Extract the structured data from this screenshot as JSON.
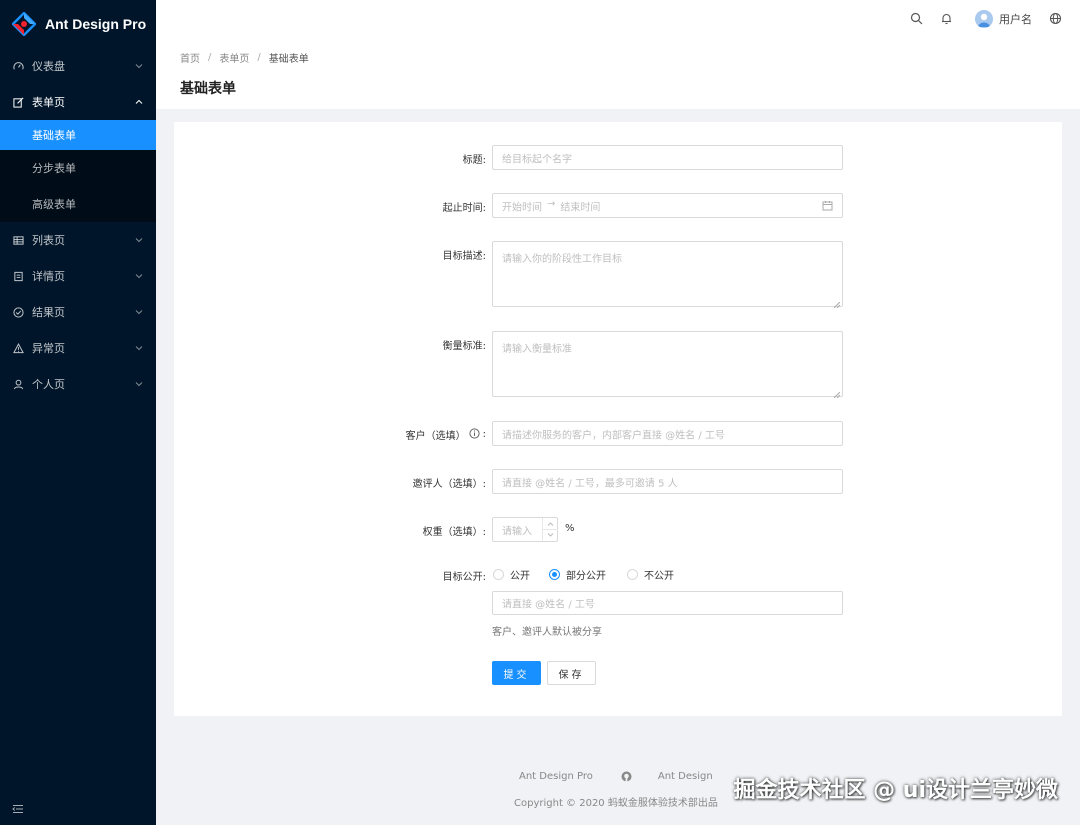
{
  "app": {
    "title": "Ant Design Pro"
  },
  "sidebar": {
    "items": [
      {
        "label": "仪表盘",
        "icon": "dashboard-icon"
      },
      {
        "label": "表单页",
        "icon": "form-icon",
        "open": true,
        "children": [
          {
            "label": "基础表单",
            "active": true
          },
          {
            "label": "分步表单"
          },
          {
            "label": "高级表单"
          }
        ]
      },
      {
        "label": "列表页",
        "icon": "table-icon"
      },
      {
        "label": "详情页",
        "icon": "profile-icon"
      },
      {
        "label": "结果页",
        "icon": "check-circle-icon"
      },
      {
        "label": "异常页",
        "icon": "warning-icon"
      },
      {
        "label": "个人页",
        "icon": "user-icon"
      }
    ]
  },
  "header": {
    "username": "用户名"
  },
  "breadcrumb": {
    "items": [
      "首页",
      "表单页",
      "基础表单"
    ],
    "separator": "/"
  },
  "page": {
    "title": "基础表单"
  },
  "form": {
    "title": {
      "label": "标题:",
      "placeholder": "给目标起个名字"
    },
    "date_range": {
      "label": "起止时间:",
      "start_placeholder": "开始时间",
      "arrow": "→",
      "end_placeholder": "结束时间"
    },
    "goal": {
      "label": "目标描述:",
      "placeholder": "请输入你的阶段性工作目标"
    },
    "standard": {
      "label": "衡量标准:",
      "placeholder": "请输入衡量标准"
    },
    "client": {
      "label": "客户（选填）",
      "suffix": ":",
      "placeholder": "请描述你服务的客户，内部客户直接 @姓名 / 工号"
    },
    "invites": {
      "label": "邀评人（选填）:",
      "placeholder": "请直接 @姓名 / 工号，最多可邀请 5 人"
    },
    "weight": {
      "label": "权重（选填）:",
      "placeholder": "请输入",
      "unit": "%"
    },
    "public": {
      "label": "目标公开:",
      "options": [
        "公开",
        "部分公开",
        "不公开"
      ],
      "selected": "部分公开",
      "input_placeholder": "请直接 @姓名 / 工号",
      "help": "客户、邀评人默认被分享"
    },
    "submit_label": "提交",
    "save_label": "保存"
  },
  "footer": {
    "links": [
      "Ant Design Pro",
      "Ant Design"
    ],
    "copyright": "Copyright © 2020 蚂蚁金服体验技术部出品"
  },
  "watermark": "掘金技术社区 @ ui设计兰亭妙微",
  "colors": {
    "primary": "#1890ff",
    "sider": "#001529",
    "sub_menu": "#000c17"
  }
}
